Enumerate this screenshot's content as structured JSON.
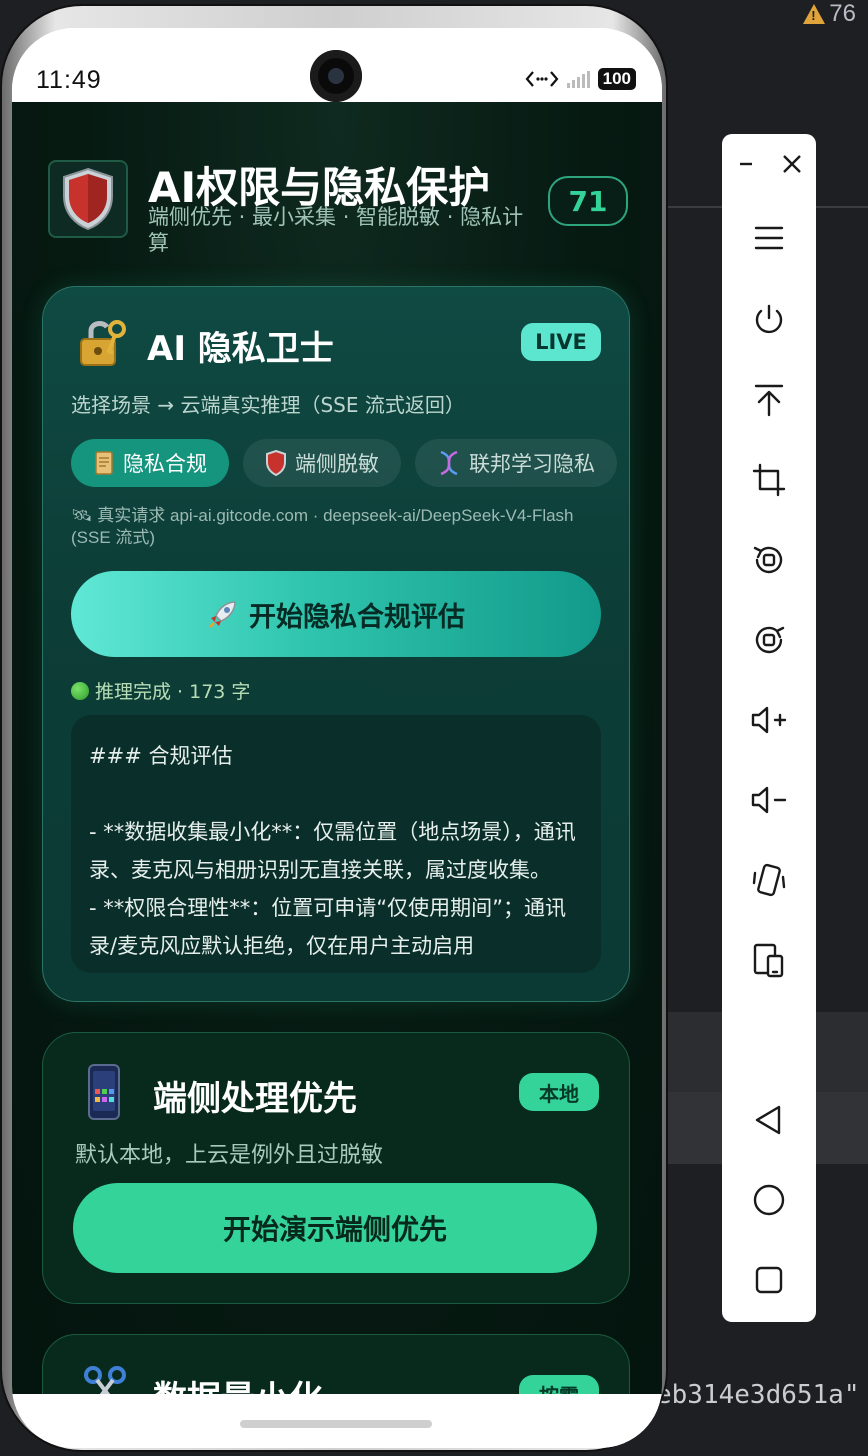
{
  "ide": {
    "warning_count": "76",
    "code_fragment": "eb314e3d651a\""
  },
  "status_bar": {
    "time": "11:49",
    "battery": "100"
  },
  "header": {
    "title": "AI权限与隐私保护",
    "subtitle": "端侧优先 · 最小采集 · 智能脱敏 · 隐私计算",
    "score": "71"
  },
  "ai_card": {
    "title": "AI 隐私卫士",
    "badge": "LIVE",
    "description": "选择场景 → 云端真实推理（SSE 流式返回）",
    "chips": [
      {
        "label": "隐私合规",
        "icon": "scroll-icon",
        "active": true
      },
      {
        "label": "端侧脱敏",
        "icon": "shield-icon",
        "active": false
      },
      {
        "label": "联邦学习隐私",
        "icon": "dna-icon",
        "active": false
      }
    ],
    "endpoint": "🛰 真实请求 api-ai.gitcode.com · deepseek-ai/DeepSeek-V4-Flash (SSE 流式)",
    "start_button": "开始隐私合规评估",
    "status": "推理完成 · 173 字",
    "output": "### 合规评估\n\n- **数据收集最小化**：仅需位置（地点场景），通讯录、麦克风与相册识别无直接关联，属过度收集。\n- **权限合理性**：位置可申请“仅使用期间”；通讯录/麦克风应默认拒绝，仅在用户主动启用"
  },
  "device_card": {
    "title": "端侧处理优先",
    "badge": "本地",
    "description": "默认本地，上云是例外且过脱敏",
    "button": "开始演示端侧优先"
  },
  "minimize_card": {
    "title": "数据最小化",
    "badge": "按需"
  },
  "colors": {
    "accent": "#34d399",
    "teal": "#15957e",
    "background": "#061a12",
    "live_badge": "#5ce6cf"
  },
  "toolbar": {
    "items": [
      "minimize-icon",
      "close-icon",
      "menu-icon",
      "power-icon",
      "pin-top-icon",
      "crop-icon",
      "rotate-left-icon",
      "rotate-right-icon",
      "volume-up-icon",
      "volume-down-icon",
      "shake-icon",
      "fold-icon",
      "back-icon",
      "home-icon",
      "recents-icon"
    ]
  }
}
